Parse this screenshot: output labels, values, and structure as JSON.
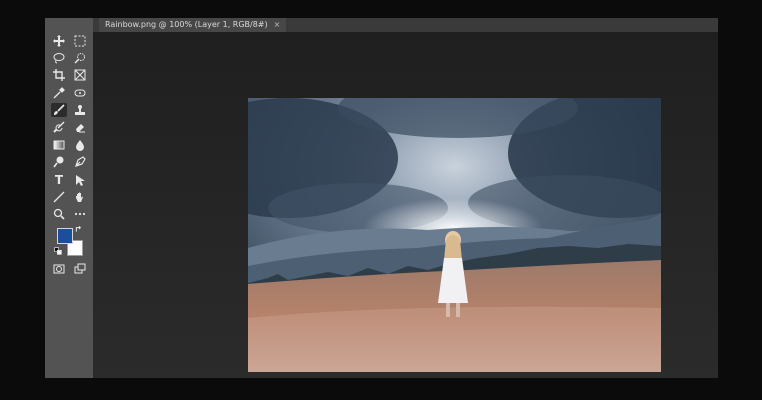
{
  "document": {
    "tab_title": "Rainbow.png @ 100% (Layer 1, RGB/8#)",
    "close_glyph": "×"
  },
  "colors": {
    "foreground": "#1a4f9a",
    "background": "#ffffff",
    "workspace": "#262626",
    "toolbar": "#535353"
  },
  "tools": [
    {
      "name": "move-tool-icon"
    },
    {
      "name": "rectangular-marquee-tool-icon"
    },
    {
      "name": "lasso-tool-icon"
    },
    {
      "name": "quick-selection-tool-icon"
    },
    {
      "name": "crop-tool-icon"
    },
    {
      "name": "frame-tool-icon"
    },
    {
      "name": "eyedropper-tool-icon"
    },
    {
      "name": "spot-healing-tool-icon"
    },
    {
      "name": "brush-tool-icon",
      "active": true
    },
    {
      "name": "clone-stamp-tool-icon"
    },
    {
      "name": "history-brush-tool-icon"
    },
    {
      "name": "eraser-tool-icon"
    },
    {
      "name": "gradient-tool-icon"
    },
    {
      "name": "blur-tool-icon"
    },
    {
      "name": "dodge-tool-icon"
    },
    {
      "name": "pen-tool-icon"
    },
    {
      "name": "type-tool-icon"
    },
    {
      "name": "path-selection-tool-icon"
    },
    {
      "name": "line-tool-icon"
    },
    {
      "name": "hand-tool-icon"
    },
    {
      "name": "zoom-tool-icon"
    },
    {
      "name": "more-tools-icon"
    }
  ]
}
